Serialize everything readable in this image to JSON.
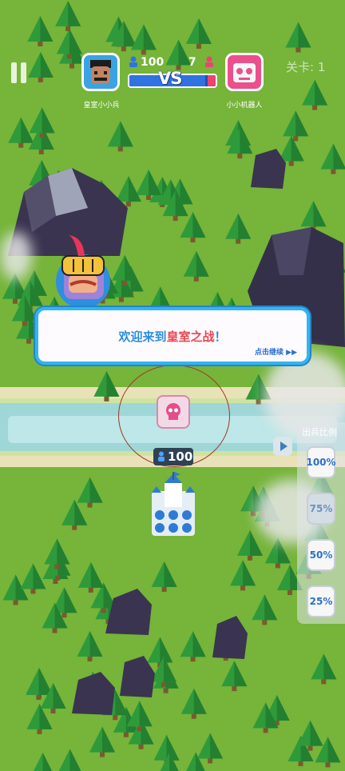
{
  "header": {
    "player_left_name": "皇室小小兵",
    "player_right_name": "小小机器人",
    "left_score": "100",
    "right_score": "7",
    "vs_label": "VS",
    "level_label": "关卡: 1",
    "left_fill_fraction": 0.88
  },
  "dialog": {
    "text_prefix": "欢迎来到",
    "text_highlight": "皇室之战",
    "text_suffix": "！",
    "continue_hint": "点击继续 ▶▶"
  },
  "speed_panel": {
    "title": "出兵比例",
    "options": [
      "100%",
      "75%",
      "50%",
      "25%"
    ],
    "selected": "75%"
  },
  "castle": {
    "troop_count": "100"
  },
  "colors": {
    "grass": "#76b43a",
    "river": "#9fd6d8",
    "dialog_border": "#35b3f0",
    "player_blue": "#2f72e0",
    "enemy_pink": "#e9456f"
  },
  "icons": [
    "pause-icon",
    "player-avatar-icon",
    "robot-avatar-icon",
    "person-icon",
    "knight-helmet-icon",
    "skull-icon",
    "castle-icon",
    "play-icon"
  ]
}
